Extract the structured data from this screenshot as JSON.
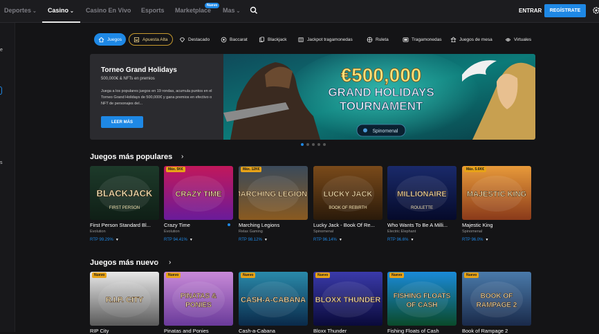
{
  "nav": {
    "items": [
      {
        "label": "Deportes",
        "chevron": true
      },
      {
        "label": "Casino",
        "chevron": true,
        "active": true
      },
      {
        "label": "Casino En Vivo",
        "chevron": false
      },
      {
        "label": "Esports",
        "chevron": false
      },
      {
        "label": "Marketplace",
        "chevron": false
      },
      {
        "label": "Mas",
        "chevron": true
      }
    ],
    "marketplace_badge": "Nuevo",
    "login_label": "ENTRAR",
    "register_label": "REGÍSTRATE",
    "search_icon": "search-icon",
    "settings_icon": "gear-icon"
  },
  "sidebar": {
    "fragments": [
      "e",
      "s"
    ]
  },
  "categories": [
    {
      "label": "Juegos",
      "icon": "home-icon",
      "active": true
    },
    {
      "label": "Apuesta Alta",
      "icon": "crown-icon",
      "outlined": true
    },
    {
      "label": "Destacado",
      "icon": "diamond-icon"
    },
    {
      "label": "Baccarat",
      "icon": "cards-icon"
    },
    {
      "label": "Blackjack",
      "icon": "cards-icon"
    },
    {
      "label": "Jackpot tragamonedas",
      "icon": "jackpot-icon"
    },
    {
      "label": "Ruleta",
      "icon": "roulette-icon"
    },
    {
      "label": "Tragamonedas",
      "icon": "slot-icon"
    },
    {
      "label": "Juegos de mesa",
      "icon": "table-icon"
    },
    {
      "label": "Virtuales",
      "icon": "virtual-icon"
    }
  ],
  "hero": {
    "title": "Torneo Grand Holidays",
    "subtitle": "500,000€ & NFTs en premios",
    "description": "Juega a los populares juegos en 19 rondas, acumula puntos en el Torneo Grand Holidays de 500,000€ y gana premios en efectivo o NFT de personajes del...",
    "button": "LEER MÁS",
    "banner_amount": "€500,000",
    "banner_line1": "GRAND HOLIDAYS",
    "banner_line2": "TOURNAMENT",
    "banner_brand": "Spinomenal",
    "dots": 5,
    "active_dot": 0
  },
  "popular": {
    "title": "Juegos más populares",
    "games": [
      {
        "name": "First Person Standard Bl...",
        "provider": "Evolution",
        "rtp": "RTP 99.29%",
        "badge": "",
        "art": "BLACKJACK",
        "art_sub": "FIRST PERSON",
        "colors": [
          "#1d3a2a",
          "#0f1f16"
        ]
      },
      {
        "name": "Crazy Time",
        "provider": "Evolution",
        "rtp": "RTP 94.41%",
        "badge": "Máx. 5K€",
        "art": "CRAZY TIME",
        "art_sub": "",
        "colors": [
          "#c2185b",
          "#6a1b9a"
        ],
        "live": true
      },
      {
        "name": "Marching Legions",
        "provider": "Relax Gaming",
        "rtp": "RTP 98.12%",
        "badge": "Máx. 12K€",
        "art": "MARCHING LEGIONS",
        "art_sub": "",
        "colors": [
          "#3a4a5a",
          "#8a5a20"
        ]
      },
      {
        "name": "Lucky Jack - Book Of Re...",
        "provider": "Spinomenal",
        "rtp": "RTP 96.14%",
        "badge": "",
        "art": "LUCKY JACK",
        "art_sub": "BOOK OF REBIRTH",
        "colors": [
          "#7a4a1a",
          "#2a1a0a"
        ]
      },
      {
        "name": "Who Wants To Be A Milli...",
        "provider": "Electric Elephant",
        "rtp": "RTP 96.6%",
        "badge": "",
        "art": "MILLIONAIRE",
        "art_sub": "ROULETTE",
        "colors": [
          "#1a2a6a",
          "#050a2a"
        ]
      },
      {
        "name": "Majestic King",
        "provider": "Spinomenal",
        "rtp": "RTP 96.0%",
        "badge": "Máx. 5.6K€",
        "art": "MAJESTIC KING",
        "art_sub": "",
        "colors": [
          "#e89a3a",
          "#8a3a1a"
        ]
      }
    ]
  },
  "new_games": {
    "title": "Juegos más nuevo",
    "badge": "Nuevo",
    "games": [
      {
        "name": "RIP City",
        "art": "R.I.P. CITY",
        "colors": [
          "#e8e8e8",
          "#5a5a5a"
        ]
      },
      {
        "name": "Pinatas and Ponies",
        "art": "PINATAS & PONIES",
        "colors": [
          "#c88ad8",
          "#6a3a9a"
        ]
      },
      {
        "name": "Cash-a-Cabana",
        "art": "CASH-A-CABANA",
        "colors": [
          "#2a8aaa",
          "#0a2a4a"
        ]
      },
      {
        "name": "Bloxx Thunder",
        "art": "BLOXX THUNDER",
        "colors": [
          "#3a3aaa",
          "#0a0a3a"
        ]
      },
      {
        "name": "Fishing Floats of Cash",
        "art": "FISHING FLOATS OF CASH",
        "colors": [
          "#1a8ad8",
          "#0a4a2a"
        ]
      },
      {
        "name": "Book of Rampage 2",
        "art": "BOOK OF RAMPAGE 2",
        "colors": [
          "#4a7aaa",
          "#1a2a4a"
        ]
      }
    ]
  }
}
